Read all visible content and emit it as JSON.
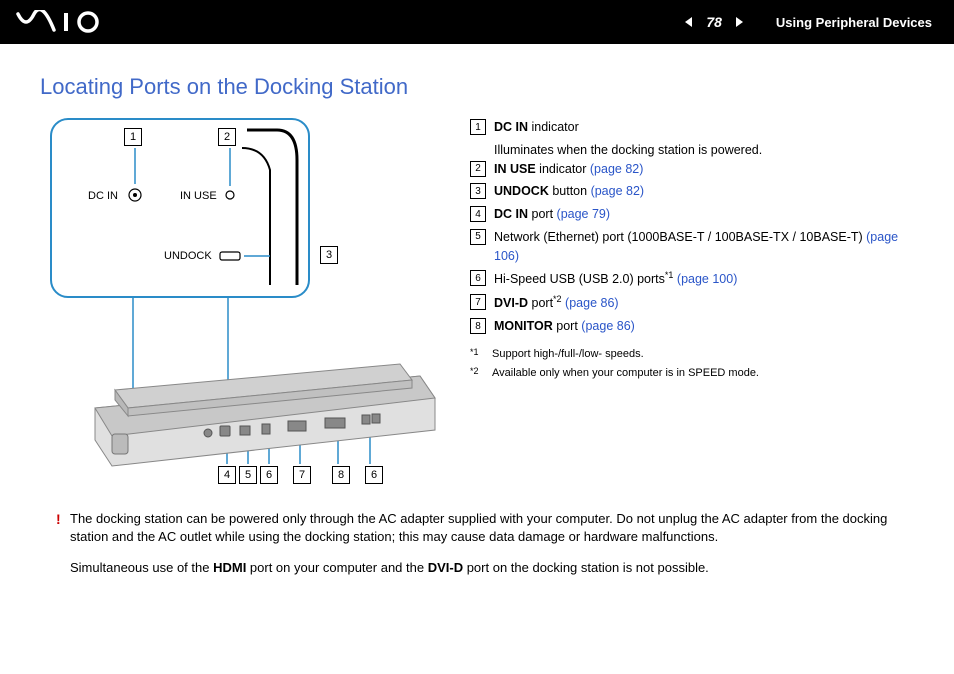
{
  "header": {
    "page_number": "78",
    "section_title": "Using Peripheral Devices"
  },
  "heading": "Locating Ports on the Docking Station",
  "diagram": {
    "inset_labels": {
      "dc_in": "DC IN",
      "in_use": "IN USE",
      "undock": "UNDOCK"
    },
    "callouts": {
      "n1": "1",
      "n2": "2",
      "n3": "3",
      "n4": "4",
      "n5": "5",
      "n6": "6",
      "n7": "7",
      "n8": "8"
    }
  },
  "items": [
    {
      "n": "1",
      "label": "DC IN",
      "rest": " indicator",
      "sub": "Illuminates when the docking station is powered."
    },
    {
      "n": "2",
      "label": "IN USE",
      "rest": " indicator ",
      "link": "(page 82)"
    },
    {
      "n": "3",
      "label": "UNDOCK",
      "rest": " button ",
      "link": "(page 82)"
    },
    {
      "n": "4",
      "label": "DC IN",
      "rest": " port ",
      "link": "(page 79)"
    },
    {
      "n": "5",
      "plain": "Network (Ethernet) port (1000BASE-T / 100BASE-TX / 10BASE-T) ",
      "link": "(page 106)"
    },
    {
      "n": "6",
      "plain_pre": "Hi-Speed USB (USB 2.0) ports",
      "sup": "*1",
      "plain_post": " ",
      "link": "(page 100)"
    },
    {
      "n": "7",
      "label": "DVI-D",
      "rest": " port",
      "sup": "*2",
      "post": " ",
      "link": "(page 86)"
    },
    {
      "n": "8",
      "label": "MONITOR",
      "rest": " port ",
      "link": "(page 86)"
    }
  ],
  "footnotes": [
    {
      "mark": "*1",
      "text": "Support high-/full-/low- speeds."
    },
    {
      "mark": "*2",
      "text": "Available only when your computer is in SPEED mode."
    }
  ],
  "warning": "The docking station can be powered only through the AC adapter supplied with your computer. Do not unplug the AC adapter from the docking station and the AC outlet while using the docking station; this may cause data damage or hardware malfunctions.",
  "note": {
    "pre": "Simultaneous use of the ",
    "b1": "HDMI",
    "mid": " port on your computer and the ",
    "b2": "DVI-D",
    "post": " port on the docking station is not possible."
  }
}
